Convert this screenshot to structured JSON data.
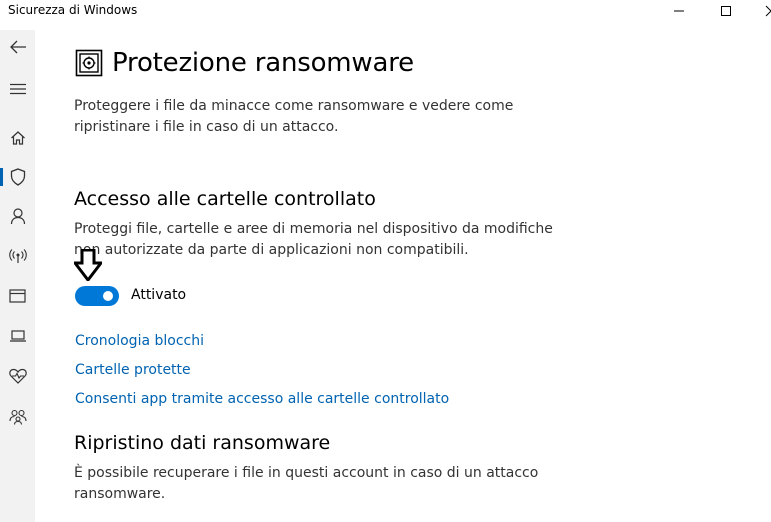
{
  "window": {
    "title": "Sicurezza di Windows"
  },
  "sidebar": {
    "icons": [
      "back-arrow-icon",
      "hamburger-menu-icon",
      "home-icon",
      "shield-icon",
      "person-icon",
      "wireless-antenna-icon",
      "app-browser-icon",
      "laptop-icon",
      "heart-pulse-icon",
      "family-icon"
    ],
    "active_item": "shield-icon"
  },
  "main": {
    "page_title": "Protezione ransomware",
    "page_description": "Proteggere i file da minacce come ransomware e vedere come ripristinare i file in caso di un attacco.",
    "controlled_folder": {
      "heading": "Accesso alle cartelle controllato",
      "description": "Proteggi file, cartelle e aree di memoria nel dispositivo da modifiche non autorizzate da parte di applicazioni non compatibili.",
      "toggle_state": "on",
      "toggle_label": "Attivato",
      "links": {
        "block_history": "Cronologia blocchi",
        "protected_folders": "Cartelle protette",
        "allow_app": "Consenti app tramite accesso alle cartelle controllato"
      }
    },
    "recovery": {
      "heading": "Ripristino dati ransomware",
      "description": "È possibile recuperare i file in questi account in caso di un attacco ransomware."
    }
  },
  "colors": {
    "accent": "#0078d7",
    "link": "#0063b1",
    "sidebar_bg": "#f2f2f2"
  }
}
